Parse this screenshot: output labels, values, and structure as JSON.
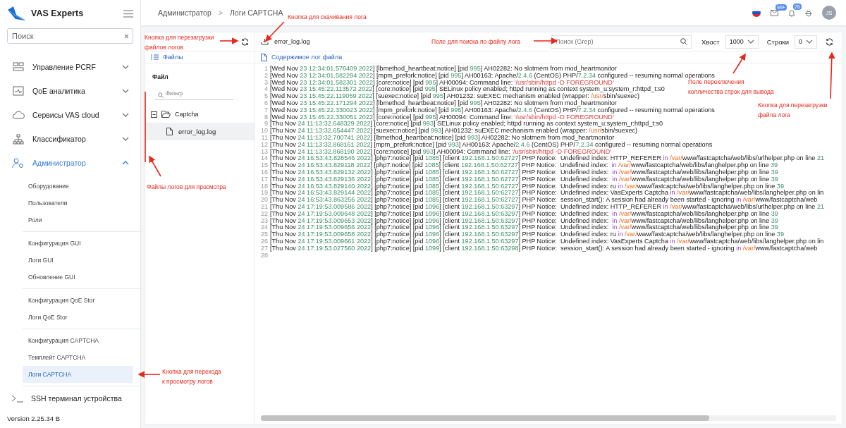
{
  "sidebar": {
    "logo_text": "VAS Experts",
    "search": {
      "placeholder": "Поиск"
    },
    "menu": [
      {
        "label": "Управление PCRF",
        "expanded": false
      },
      {
        "label": "QoE аналитика",
        "expanded": false
      },
      {
        "label": "Сервисы VAS cloud",
        "expanded": false
      },
      {
        "label": "Классификатор",
        "expanded": false
      },
      {
        "label": "Администратор",
        "expanded": true,
        "sections": [
          {
            "items": [
              {
                "label": "Оборудование",
                "selected": false
              },
              {
                "label": "Пользователи",
                "selected": false
              },
              {
                "label": "Роли",
                "selected": false
              }
            ]
          },
          {
            "items": [
              {
                "label": "Конфигурация GUI",
                "selected": false
              },
              {
                "label": "Логи GUI",
                "selected": false
              },
              {
                "label": "Обновление GUI",
                "selected": false
              }
            ]
          },
          {
            "items": [
              {
                "label": "Конфигурация QoE Stor",
                "selected": false
              },
              {
                "label": "Логи QoE Stor",
                "selected": false
              }
            ]
          },
          {
            "items": [
              {
                "label": "Конфигурация CAPTCHA",
                "selected": false
              },
              {
                "label": "Темплейт CAPTCHA",
                "selected": false
              },
              {
                "label": "Логи CAPTCHA",
                "selected": true
              }
            ]
          }
        ]
      },
      {
        "label": "SSH терминал устройства",
        "expanded": false
      }
    ],
    "version": "Version 2.25.34 B"
  },
  "topbar": {
    "breadcrumb": [
      "Администратор",
      "Логи CAPTCHA"
    ],
    "separator": ">",
    "mail_badge": "99+",
    "bell_badge": "26",
    "avatar": "JS"
  },
  "files": {
    "tab": "Файлы",
    "header": "Файл",
    "filter_placeholder": "Фильтр",
    "tree": [
      {
        "label": "Captcha",
        "expanded": true,
        "children": [
          {
            "label": "error_log.log",
            "selected": true
          }
        ]
      }
    ]
  },
  "log": {
    "file_name": "error_log.log",
    "search_placeholder": "Поиск (Grep)",
    "tail": {
      "label": "Хвост",
      "value": "1000"
    },
    "rows": {
      "label": "Строки",
      "value": "0"
    },
    "tab": "Содержимое лог файла",
    "lines": [
      {
        "number": "1",
        "text": "[Wed Nov 23 12:34:01.576409 2022] [lbmethod_heartbeat:notice] [pid 995] AH02282: No slotmem from mod_heartmonitor"
      },
      {
        "number": "2",
        "text": "[Wed Nov 23 12:34:01.582294 2022] [mpm_prefork:notice] [pid 995] AH00163: Apache/2.4.6 (CentOS) PHP/7.2.34 configured -- resuming normal operations"
      },
      {
        "number": "3",
        "text": "[Wed Nov 23 12:34:01.582301 2022] [core:notice] [pid 995] AH00094: Command line: '/usr/sbin/httpd -D FOREGROUND'"
      },
      {
        "number": "4",
        "text": "[Wed Nov 23 15:45:22.113572 2022] [core:notice] [pid 995] SELinux policy enabled; httpd running as context system_u:system_r:httpd_t:s0"
      },
      {
        "number": "5",
        "text": "[Wed Nov 23 15:45:22.119059 2022] [suexec:notice] [pid 995] AH01232: suEXEC mechanism enabled (wrapper: /usr/sbin/suexec)"
      },
      {
        "number": "6",
        "text": "[Wed Nov 23 15:45:22.171294 2022] [lbmethod_heartbeat:notice] [pid 995] AH02282: No slotmem from mod_heartmonitor"
      },
      {
        "number": "7",
        "text": "[Wed Nov 23 15:45:22.330023 2022] [mpm_prefork:notice] [pid 995] AH00163: Apache/2.4.6 (CentOS) PHP/7.2.34 configured -- resuming normal operations"
      },
      {
        "number": "8",
        "text": "[Wed Nov 23 15:45:22.330051 2022] [core:notice] [pid 995] AH00094: Command line: '/usr/sbin/httpd -D FOREGROUND'"
      },
      {
        "number": "9",
        "text": "[Thu Nov 24 11:13:32.648329 2022] [core:notice] [pid 993] SELinux policy enabled; httpd running as context system_u:system_r:httpd_t:s0"
      },
      {
        "number": "10",
        "text": "[Thu Nov 24 11:13:32.654447 2022] [suexec:notice] [pid 993] AH01232: suEXEC mechanism enabled (wrapper: /usr/sbin/suexec)"
      },
      {
        "number": "11",
        "text": "[Thu Nov 24 11:13:32.700741 2022] [lbmethod_heartbeat:notice] [pid 993] AH02282: No slotmem from mod_heartmonitor"
      },
      {
        "number": "12",
        "text": "[Thu Nov 24 11:13:32.868161 2022] [mpm_prefork:notice] [pid 993] AH00163: Apache/2.4.6 (CentOS) PHP/7.2.34 configured -- resuming normal operations"
      },
      {
        "number": "13",
        "text": "[Thu Nov 24 11:13:32.868190 2022] [core:notice] [pid 993] AH00094: Command line: '/usr/sbin/httpd -D FOREGROUND'"
      },
      {
        "number": "14",
        "text": "[Thu Nov 24 16:53:43.828546 2022] [php7:notice] [pid 1085] [client 192.168.1.50:62727] PHP Notice:  Undefined index: HTTP_REFERER in /var/www/fastcaptcha/web/libs/urlhelper.php on line 21"
      },
      {
        "number": "15",
        "text": "[Thu Nov 24 16:53:43.829118 2022] [php7:notice] [pid 1085] [client 192.168.1.50:62727] PHP Notice:  Undefined index:  in /var/www/fastcaptcha/web/libs/langhelper.php on line 39"
      },
      {
        "number": "16",
        "text": "[Thu Nov 24 16:53:43.829132 2022] [php7:notice] [pid 1085] [client 192.168.1.50:62727] PHP Notice:  Undefined index:  in /var/www/fastcaptcha/web/libs/langhelper.php on line 39"
      },
      {
        "number": "17",
        "text": "[Thu Nov 24 16:53:43.829136 2022] [php7:notice] [pid 1085] [client 192.168.1.50:62727] PHP Notice:  Undefined index:  in /var/www/fastcaptcha/web/libs/langhelper.php on line 39"
      },
      {
        "number": "18",
        "text": "[Thu Nov 24 16:53:43.829140 2022] [php7:notice] [pid 1085] [client 192.168.1.50:62727] PHP Notice:  Undefined index: ru in /var/www/fastcaptcha/web/libs/langhelper.php on line 39"
      },
      {
        "number": "19",
        "text": "[Thu Nov 24 16:53:43.829144 2022] [php7:notice] [pid 1085] [client 192.168.1.50:62727] PHP Notice:  Undefined index: VasExperts Captcha in /var/www/fastcaptcha/web/libs/langhelper.php on lin"
      },
      {
        "number": "20",
        "text": "[Thu Nov 24 16:53:43.863256 2022] [php7:notice] [pid 1085] [client 192.168.1.50:62727] PHP Notice:  session_start(): A session had already been started - ignoring in /var/www/fastcaptcha/web"
      },
      {
        "number": "21",
        "text": "[Thu Nov 24 17:19:53.009586 2022] [php7:notice] [pid 1096] [client 192.168.1.50:63297] PHP Notice:  Undefined index: HTTP_REFERER in /var/www/fastcaptcha/web/libs/urlhelper.php on line 21"
      },
      {
        "number": "22",
        "text": "[Thu Nov 24 17:19:53.009648 2022] [php7:notice] [pid 1096] [client 192.168.1.50:63297] PHP Notice:  Undefined index:  in /var/www/fastcaptcha/web/libs/langhelper.php on line 39"
      },
      {
        "number": "23",
        "text": "[Thu Nov 24 17:19:53.009653 2022] [php7:notice] [pid 1096] [client 192.168.1.50:63297] PHP Notice:  Undefined index:  in /var/www/fastcaptcha/web/libs/langhelper.php on line 39"
      },
      {
        "number": "24",
        "text": "[Thu Nov 24 17:19:53.009656 2022] [php7:notice] [pid 1096] [client 192.168.1.50:63297] PHP Notice:  Undefined index:  in /var/www/fastcaptcha/web/libs/langhelper.php on line 39"
      },
      {
        "number": "25",
        "text": "[Thu Nov 24 17:19:53.009658 2022] [php7:notice] [pid 1096] [client 192.168.1.50:63297] PHP Notice:  Undefined index: ru in /var/www/fastcaptcha/web/libs/langhelper.php on line 39"
      },
      {
        "number": "26",
        "text": "[Thu Nov 24 17:19:53.009661 2022] [php7:notice] [pid 1096] [client 192.168.1.50:63297] PHP Notice:  Undefined index: VasExperts Captcha in /var/www/fastcaptcha/web/libs/langhelper.php on lin"
      },
      {
        "number": "27",
        "text": "[Thu Nov 24 17:19:53.027560 2022] [php7:notice] [pid 1099] [client 192.168.1.50:63298] PHP Notice:  session_start(): A session had already been started - ignoring in /var/www/fastcaptcha/web"
      },
      {
        "number": "28"
      }
    ]
  },
  "annotations": [
    {
      "lines": [
        "Кнопка для скачивания лога"
      ]
    },
    {
      "lines": [
        "Кнопка для перезагрузки",
        "файлов логов"
      ]
    },
    {
      "lines": [
        "Поле для поиска по файлу лога"
      ]
    },
    {
      "lines": [
        "Поле переключения",
        "колличества строк для вывода"
      ]
    },
    {
      "lines": [
        "Кнопка для перезагрузки",
        "файла лога"
      ]
    },
    {
      "lines": [
        "Файлы логов для просмотра"
      ]
    },
    {
      "lines": [
        "Кнопка для перехода",
        "к просмотру логов"
      ]
    }
  ]
}
